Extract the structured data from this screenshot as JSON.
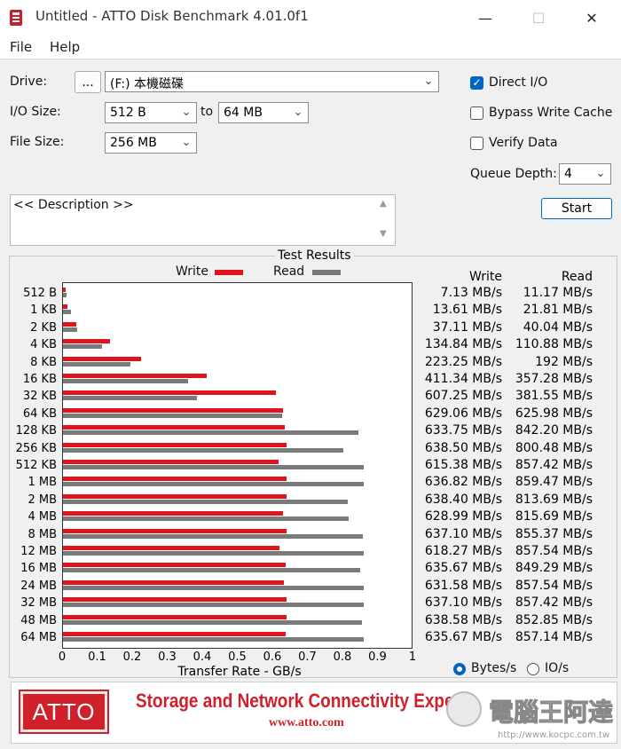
{
  "window": {
    "title": "Untitled - ATTO Disk Benchmark 4.01.0f1",
    "minimize": "—",
    "maximize": "☐",
    "close": "✕"
  },
  "menu": {
    "file": "File",
    "help": "Help"
  },
  "controls": {
    "drive_label": "Drive:",
    "browse_label": "...",
    "drive_value": "(F:) 本機磁碟",
    "io_size_label": "I/O Size:",
    "io_from": "512 B",
    "to_label": "to",
    "io_to": "64 MB",
    "file_size_label": "File Size:",
    "file_size": "256 MB",
    "direct_io_label": "Direct I/O",
    "direct_io_checked": true,
    "bypass_write_cache_label": "Bypass Write Cache",
    "bypass_write_cache_checked": false,
    "verify_data_label": "Verify Data",
    "verify_data_checked": false,
    "queue_depth_label": "Queue Depth:",
    "queue_depth": "4",
    "start_label": "Start",
    "description_text": "<< Description >>"
  },
  "results": {
    "title": "Test Results",
    "legend_write": "Write",
    "legend_read": "Read",
    "col_write": "Write",
    "col_read": "Read",
    "unit_bytes": "Bytes/s",
    "unit_io": "IO/s",
    "unit_selected": "Bytes/s"
  },
  "chart_data": {
    "type": "bar",
    "orientation": "horizontal",
    "xlabel": "Transfer Rate - GB/s",
    "xlim": [
      0,
      1
    ],
    "xticks": [
      "0",
      "0.1",
      "0.2",
      "0.3",
      "0.4",
      "0.5",
      "0.6",
      "0.7",
      "0.8",
      "0.9",
      "1"
    ],
    "categories": [
      "512 B",
      "1 KB",
      "2 KB",
      "4 KB",
      "8 KB",
      "16 KB",
      "32 KB",
      "64 KB",
      "128 KB",
      "256 KB",
      "512 KB",
      "1 MB",
      "2 MB",
      "4 MB",
      "8 MB",
      "12 MB",
      "16 MB",
      "24 MB",
      "32 MB",
      "48 MB",
      "64 MB"
    ],
    "series": [
      {
        "name": "Write",
        "color": "#e0141e",
        "values": [
          7.13,
          13.61,
          37.11,
          134.84,
          223.25,
          411.34,
          607.25,
          629.06,
          633.75,
          638.5,
          615.38,
          636.82,
          638.4,
          628.99,
          637.1,
          618.27,
          635.67,
          631.58,
          637.1,
          638.58,
          635.67
        ],
        "labels": [
          "7.13 MB/s",
          "13.61 MB/s",
          "37.11 MB/s",
          "134.84 MB/s",
          "223.25 MB/s",
          "411.34 MB/s",
          "607.25 MB/s",
          "629.06 MB/s",
          "633.75 MB/s",
          "638.50 MB/s",
          "615.38 MB/s",
          "636.82 MB/s",
          "638.40 MB/s",
          "628.99 MB/s",
          "637.10 MB/s",
          "618.27 MB/s",
          "635.67 MB/s",
          "631.58 MB/s",
          "637.10 MB/s",
          "638.58 MB/s",
          "635.67 MB/s"
        ]
      },
      {
        "name": "Read",
        "color": "#7a7a7a",
        "values": [
          11.17,
          21.81,
          40.04,
          110.88,
          192,
          357.28,
          381.55,
          625.98,
          842.2,
          800.48,
          857.42,
          859.47,
          813.69,
          815.69,
          855.37,
          857.54,
          849.29,
          857.54,
          857.42,
          852.85,
          857.14
        ],
        "labels": [
          "11.17 MB/s",
          "21.81 MB/s",
          "40.04 MB/s",
          "110.88 MB/s",
          "192 MB/s",
          "357.28 MB/s",
          "381.55 MB/s",
          "625.98 MB/s",
          "842.20 MB/s",
          "800.48 MB/s",
          "857.42 MB/s",
          "859.47 MB/s",
          "813.69 MB/s",
          "815.69 MB/s",
          "855.37 MB/s",
          "857.54 MB/s",
          "849.29 MB/s",
          "857.54 MB/s",
          "857.42 MB/s",
          "852.85 MB/s",
          "857.14 MB/s"
        ]
      }
    ]
  },
  "banner": {
    "logo": "ATTO",
    "tagline": "Storage and Network Connectivity Experts",
    "url": "www.atto.com",
    "watermark": "電腦王阿達",
    "watermark_url": "http://www.kocpc.com.tw"
  },
  "colors": {
    "accent": "#0067c0",
    "write": "#e0141e",
    "read": "#7a7a7a",
    "banner_red": "#d0202a"
  }
}
